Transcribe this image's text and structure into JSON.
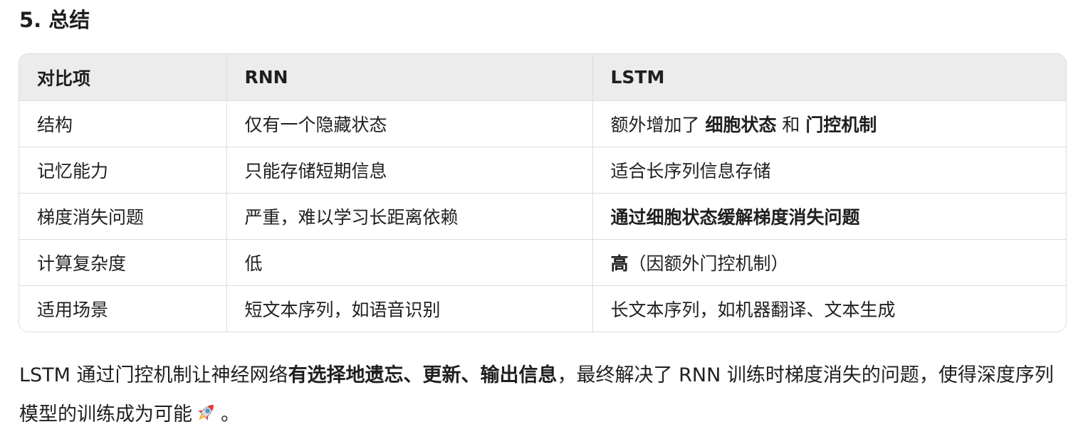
{
  "heading": "5. 总结",
  "table": {
    "headers": [
      "对比项",
      "RNN",
      "LSTM"
    ],
    "rows": [
      {
        "item": "结构",
        "rnn": "仅有一个隐藏状态",
        "lstm": {
          "pre": "额外增加了 ",
          "bold1": "细胞状态",
          "mid": " 和 ",
          "bold2": "门控机制"
        }
      },
      {
        "item": "记忆能力",
        "rnn": "只能存储短期信息",
        "lstm": "适合长序列信息存储"
      },
      {
        "item": "梯度消失问题",
        "rnn": "严重，难以学习长距离依赖",
        "lstm": "通过细胞状态缓解梯度消失问题"
      },
      {
        "item": "计算复杂度",
        "rnn": "低",
        "lstm": {
          "bold": "高",
          "rest": "（因额外门控机制）"
        }
      },
      {
        "item": "适用场景",
        "rnn": "短文本序列，如语音识别",
        "lstm": "长文本序列，如机器翻译、文本生成"
      }
    ]
  },
  "summary": {
    "pre": "LSTM 通过门控机制让神经网络",
    "bold": "有选择地遗忘、更新、输出信息",
    "post": "，最终解决了 RNN 训练时梯度消失的问题，使得深度序列模型的训练成为可能",
    "end": "。",
    "emoji_icon": "rocket-icon"
  }
}
